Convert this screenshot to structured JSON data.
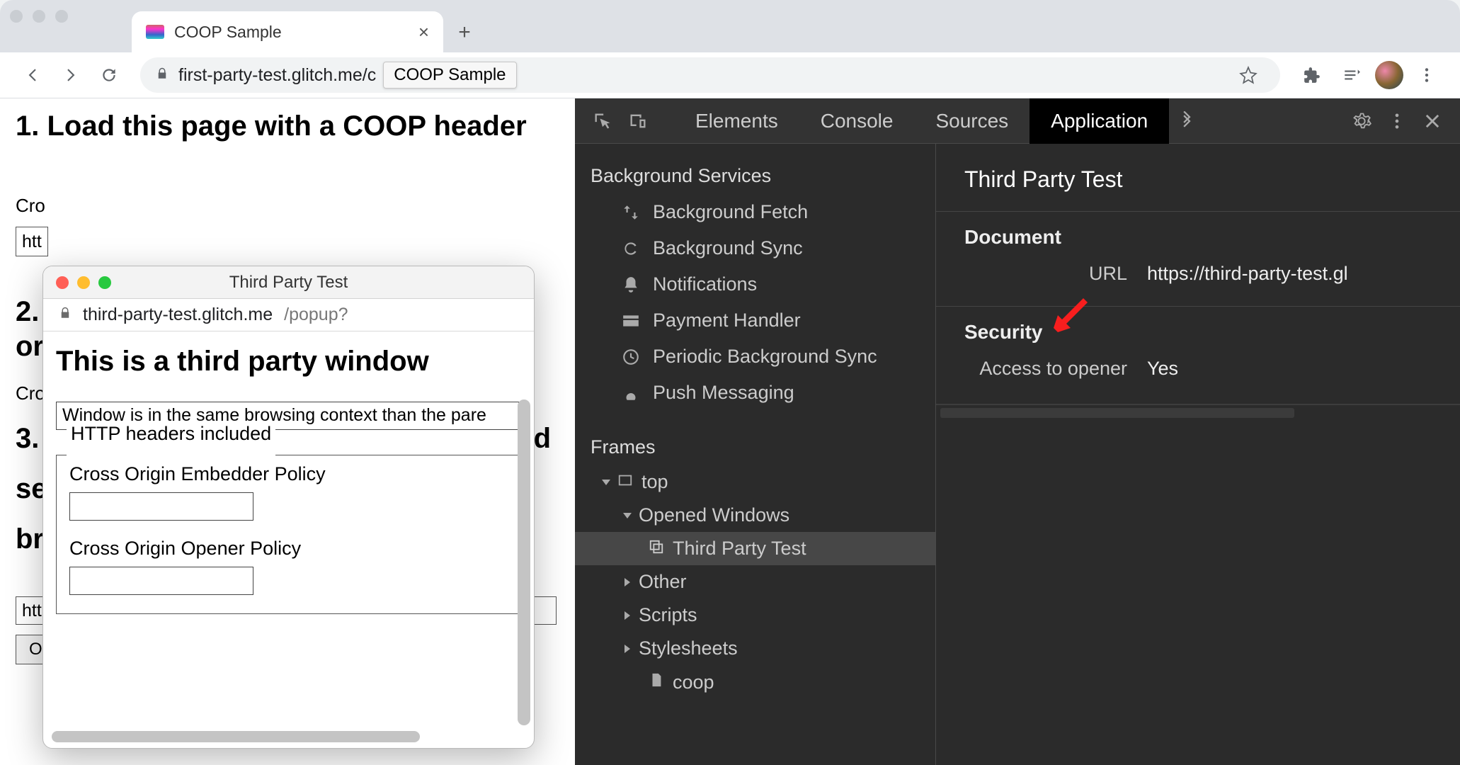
{
  "chrome": {
    "tab_title": "COOP Sample",
    "url_path_visible": "first-party-test.glitch.me/c",
    "url_tooltip": "COOP Sample"
  },
  "page": {
    "h1": "1. Load this page with a COOP header",
    "p1_stub": "Cro",
    "input_stub": "http",
    "h2a_stub_left": "2.",
    "h2a_stub_right": "or",
    "p2_stub": "Cro",
    "h3_left": "3.",
    "h3_right_d": "d",
    "h3_line2": "se",
    "h3_line3": "br",
    "popup_url_value": "https://third-party-test.glitch.me/popup?",
    "open_popup_label": "Open a popup"
  },
  "popup": {
    "title": "Third Party Test",
    "host": "third-party-test.glitch.me",
    "path": "/popup?",
    "h1": "This is a third party window",
    "context_msg": "Window is in the same browsing context than the pare",
    "fieldset_legend": "HTTP headers included",
    "coep_label": "Cross Origin Embedder Policy",
    "coop_label": "Cross Origin Opener Policy"
  },
  "devtools": {
    "tabs": {
      "elements": "Elements",
      "console": "Console",
      "sources": "Sources",
      "application": "Application"
    },
    "sidebar": {
      "bg_services": "Background Services",
      "items": {
        "bg_fetch": "Background Fetch",
        "bg_sync": "Background Sync",
        "notifications": "Notifications",
        "payment_handler": "Payment Handler",
        "periodic_bg_sync": "Periodic Background Sync",
        "push_messaging": "Push Messaging"
      },
      "frames": "Frames",
      "tree": {
        "top": "top",
        "opened_windows": "Opened Windows",
        "third_party_test": "Third Party Test",
        "other": "Other",
        "scripts": "Scripts",
        "stylesheets": "Stylesheets",
        "coop": "coop"
      }
    },
    "panel": {
      "title": "Third Party Test",
      "document_hdr": "Document",
      "url_label": "URL",
      "url_value": "https://third-party-test.gl",
      "security_hdr": "Security",
      "access_opener_label": "Access to opener",
      "access_opener_value": "Yes"
    }
  }
}
